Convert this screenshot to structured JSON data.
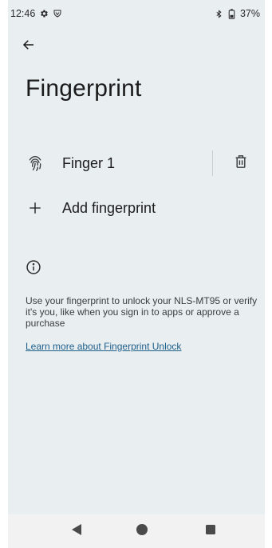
{
  "status_bar": {
    "time": "12:46",
    "battery": "37%",
    "icons": [
      "gear-icon",
      "shield-icon",
      "bluetooth-icon",
      "battery-icon"
    ]
  },
  "header": {
    "back_icon": "arrow-left-icon",
    "title": "Fingerprint"
  },
  "fingerprints": [
    {
      "label": "Finger 1",
      "icon": "fingerprint-icon",
      "action_icon": "trash-icon"
    }
  ],
  "add_fingerprint": {
    "label": "Add fingerprint",
    "icon": "plus-icon"
  },
  "info": {
    "icon": "info-icon",
    "text": "Use your fingerprint to unlock your NLS-MT95 or verify it's you, like when you sign in to apps or approve a purchase",
    "link": "Learn more about Fingerprint Unlock"
  },
  "nav_bar": {
    "icons": [
      "nav-back-icon",
      "nav-home-icon",
      "nav-recents-icon"
    ]
  },
  "colors": {
    "background": "#e9eef1",
    "text": "#1b1b1b",
    "link": "#1e5f8a",
    "nav_bar": "#f2f2f2"
  }
}
